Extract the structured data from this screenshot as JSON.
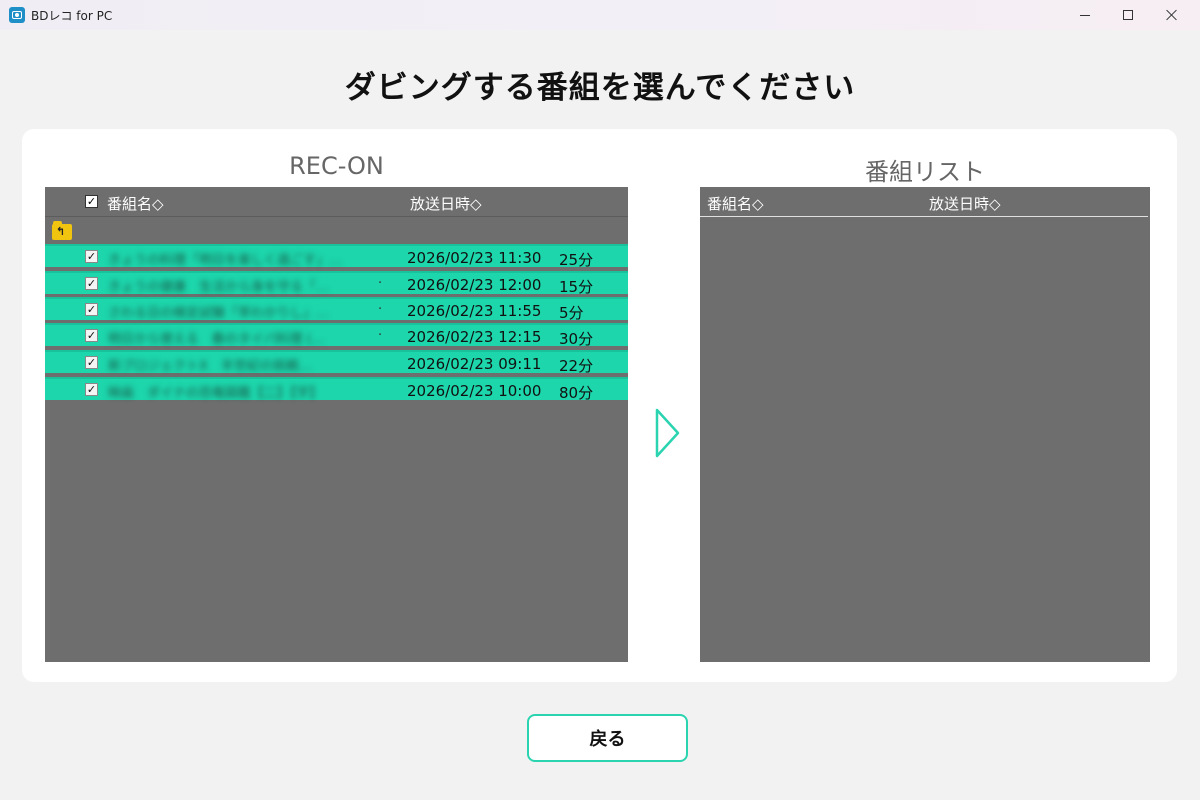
{
  "window": {
    "title": "BDレコ for PC"
  },
  "page": {
    "title": "ダビングする番組を選んでください"
  },
  "left_panel": {
    "title": "REC-ON",
    "header": {
      "name_label": "番組名◇",
      "date_label": "放送日時◇",
      "select_all_checked": true
    },
    "rows": [
      {
        "name": "きょうの料理「明日を楽しく過ごす」…",
        "date": "2026/02/23 11:30",
        "duration": "25分",
        "checked": true,
        "has_dot": false
      },
      {
        "name": "きょうの健康　生活から身を守る「…",
        "date": "2026/02/23 12:00",
        "duration": "15分",
        "checked": true,
        "has_dot": true
      },
      {
        "name": "さわる日の検定試験「早わかりし」…",
        "date": "2026/02/23 11:55",
        "duration": "5分",
        "checked": true,
        "has_dot": true
      },
      {
        "name": "明日から使える　春のタイパ料理 (…",
        "date": "2026/02/23 12:15",
        "duration": "30分",
        "checked": true,
        "has_dot": true
      },
      {
        "name": "新プロジェクトX　半世紀の挑戦…",
        "date": "2026/02/23 09:11",
        "duration": "22分",
        "checked": true,
        "has_dot": false
      },
      {
        "name": "映画　ダイナの恐竜図鑑【二】【字】",
        "date": "2026/02/23 10:00",
        "duration": "80分",
        "checked": true,
        "has_dot": false
      }
    ]
  },
  "right_panel": {
    "title": "番組リスト",
    "header": {
      "name_label": "番組名◇",
      "date_label": "放送日時◇"
    }
  },
  "footer": {
    "back_label": "戻る"
  },
  "colors": {
    "row_bg": "#1dd6ac",
    "list_bg": "#6e6e6e",
    "accent": "#2bd4b0"
  }
}
